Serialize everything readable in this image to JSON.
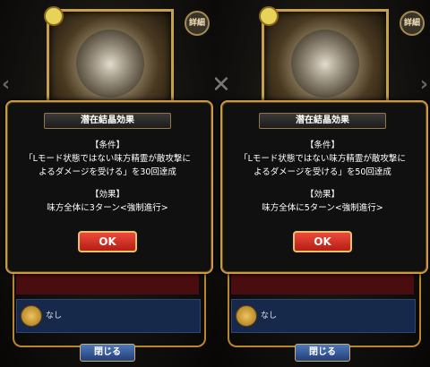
{
  "panels": [
    {
      "detail_label": "詳細",
      "dialog": {
        "title": "潜在結晶効果",
        "condition_header": "【条件】",
        "condition_line1": "「Lモード状態ではない味方精霊が敵攻撃に",
        "condition_line2": "よるダメージを受ける」を30回達成",
        "effect_header": "【効果】",
        "effect_text": "味方全体に3ターン<強制進行>",
        "ok_label": "OK"
      },
      "list_row_text": "なし",
      "close_label": "閉じる"
    },
    {
      "detail_label": "詳細",
      "dialog": {
        "title": "潜在結晶効果",
        "condition_header": "【条件】",
        "condition_line1": "「Lモード状態ではない味方精霊が敵攻撃に",
        "condition_line2": "よるダメージを受ける」を50回達成",
        "effect_header": "【効果】",
        "effect_text": "味方全体に5ターン<強制進行>",
        "ok_label": "OK"
      },
      "list_row_text": "なし",
      "close_label": "閉じる"
    }
  ],
  "icons": {
    "nav_prev": "chevron-left-icon",
    "nav_next": "chevron-right-icon",
    "divider_close": "x-icon"
  },
  "colors": {
    "frame_gold": "#c99a46",
    "ok_red": "#d23024",
    "close_blue": "#3a5ea0"
  }
}
